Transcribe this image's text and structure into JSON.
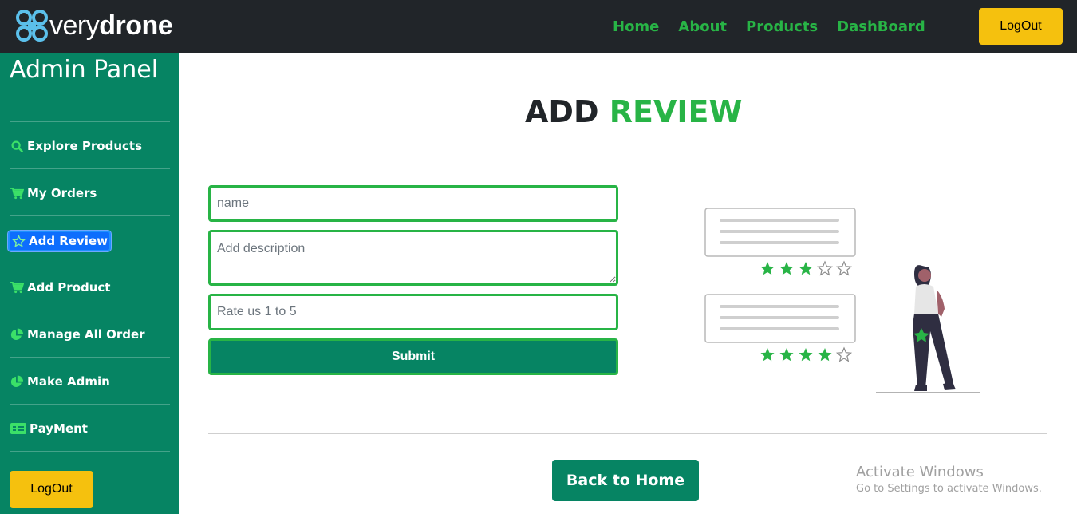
{
  "brand": {
    "name_light": "very",
    "name_bold": "drone"
  },
  "nav": {
    "links": [
      "Home",
      "About",
      "Products",
      "DashBoard"
    ],
    "logout_label": "LogOut"
  },
  "sidebar": {
    "title": "Admin Panel",
    "items": [
      {
        "label": "Explore Products",
        "icon": "search-icon"
      },
      {
        "label": "My Orders",
        "icon": "cart-icon"
      },
      {
        "label": "Add Review",
        "icon": "star-icon",
        "active": true
      },
      {
        "label": "Add Product",
        "icon": "cart-icon"
      },
      {
        "label": "Manage All Order",
        "icon": "pie-chart-icon"
      },
      {
        "label": "Make Admin",
        "icon": "pie-chart-icon"
      },
      {
        "label": "PayMent",
        "icon": "payment-card-icon"
      }
    ],
    "logout_label": "LogOut"
  },
  "main": {
    "title_part1": "ADD",
    "title_part2": "REVIEW",
    "form": {
      "name_placeholder": "name",
      "description_placeholder": "Add description",
      "rating_placeholder": "Rate us 1 to 5",
      "submit_label": "Submit"
    },
    "illustration": {
      "review1_stars": 3,
      "review2_stars": 4,
      "max_stars": 5
    },
    "back_label": "Back to Home"
  },
  "watermark": {
    "line1": "Activate Windows",
    "line2": "Go to Settings to activate Windows."
  },
  "colors": {
    "navbar_bg": "#212529",
    "accent_green": "#28b446",
    "sidebar_bg": "#068463",
    "logout_yellow": "#f5c10e",
    "active_blue": "#0d6efd"
  }
}
